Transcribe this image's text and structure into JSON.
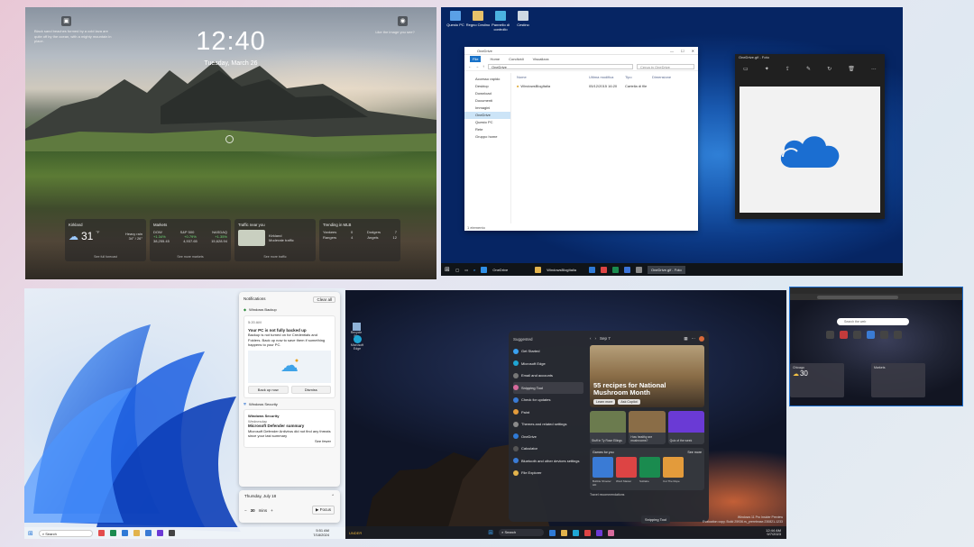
{
  "lock_screen": {
    "time": "12:40",
    "date": "Tuesday, March 26",
    "spotlight_text": "Black sand beaches formed by a cold lava are quite off by the ocean, with a mighty mountain in place.",
    "like_text": "Like the image you see?",
    "weather": {
      "title": "Kirkland",
      "temp": "31",
      "unit": "°F",
      "desc": "Heavy rain",
      "range": "34° / 26°",
      "link": "See full forecast"
    },
    "markets": {
      "title": "Markets",
      "cols": [
        "DOW",
        "S&P 500",
        "NASDAQ"
      ],
      "changes": [
        "+1.34%",
        "+0.79%",
        "+1.35%"
      ],
      "values": [
        "38,255.45",
        "4,937.65",
        "15,628.94"
      ],
      "link": "See more markets"
    },
    "traffic": {
      "title": "Traffic near you",
      "place": "Kirkland",
      "desc": "Moderate traffic",
      "link": "See more traffic"
    },
    "trending": {
      "title": "Trending in MLB",
      "rows": [
        [
          "Yankees",
          "0",
          "Dodgers",
          "7"
        ],
        [
          "Rangers",
          "4",
          "Angels",
          "12"
        ]
      ]
    }
  },
  "win10": {
    "desktop_icons": [
      "Questo PC",
      "Regno Cestino",
      "Pannello di controllo",
      "Cestino"
    ],
    "explorer": {
      "title": "OneDrive",
      "ribbon": [
        "File",
        "Home",
        "Condividi",
        "Visualizza"
      ],
      "path": "OneDrive",
      "search": "Cerca in OneDrive",
      "nav": [
        "Accesso rapido",
        "Desktop",
        "Download",
        "Documenti",
        "Immagini",
        "OneDrive",
        "Questo PC",
        "Rete",
        "Gruppo home"
      ],
      "columns": [
        "Nome",
        "Ultima modifica",
        "Tipo",
        "Dimensione"
      ],
      "rows": [
        [
          "WindowsBlogItalia",
          "05/12/2015 16:20",
          "Cartella di file",
          ""
        ]
      ],
      "status": "1 elemento"
    },
    "photos_title": "OneDrive.gif - Foto",
    "taskbar": [
      "OneDrive",
      "WindowsBlogItalia",
      "OneDrive.gif - Foto"
    ]
  },
  "win11_notifications": {
    "header": "Notifications",
    "clear": "Clear all",
    "app1": "Windows Backup",
    "time1": "5:20 AM",
    "title1": "Your PC is not fully backed up",
    "body1": "Backup is not turned on for Credentials and Folders. Back up now to save them if something happens to your PC.",
    "btn_back": "Back up now",
    "btn_dismiss": "Dismiss",
    "app2": "Windows Security",
    "sub2": "Windows Security",
    "day2": "Wednesday",
    "title2": "Microsoft Defender summary",
    "body2": "Microsoft Defender Antivirus did not find any threats since your last summary",
    "btn_see": "See fewer",
    "cal_date": "Thursday, July 18",
    "focus_value": "30",
    "focus_unit": "mins",
    "focus_btn": "▶ Focus",
    "taskbar_search": "Search",
    "clock_time": "5:51 AM",
    "clock_date": "7/18/2024"
  },
  "win11_start": {
    "suggested": "Suggested",
    "items": [
      "Get Started",
      "Microsoft Edge",
      "Email and accounts",
      "Snipping Tool",
      "Check for updates",
      "Paint",
      "Themes and related settings",
      "OneDrive",
      "Calculator",
      "Bluetooth and other devices settings",
      "File Explorer"
    ],
    "date": "Sep 7",
    "hero_title": "55 recipes for National Mushroom Month",
    "hero_btn1": "Learn more",
    "hero_btn2": "Ask Copilot",
    "tiles": [
      "Stuff in Ty Rose Ellings",
      "How healthy are mushrooms?",
      "Quiz of the week"
    ],
    "games_title": "Games for you",
    "games_more": "See more",
    "games": [
      "Bubble Shooter HD",
      "Word Master",
      "Solitaire",
      "Cut The Rope"
    ],
    "travel": "Travel recommendations",
    "taskbar_search": "Search",
    "tooltip": "Snipping Tool",
    "recycle": "Recycle Bin",
    "edge": "Microsoft Edge",
    "build": "Windows 11 Pro Insider Preview",
    "build2": "Evaluation copy. Build 25936.rs_prerelease.230821-1233",
    "weather_left": "UNDER",
    "clock_time": "12:44 AM",
    "clock_date": "9/7/2023"
  },
  "edge": {
    "search_placeholder": "Search the web",
    "w1_title": "Chicago",
    "w1_temp": "30",
    "w2_title": "Markets"
  }
}
